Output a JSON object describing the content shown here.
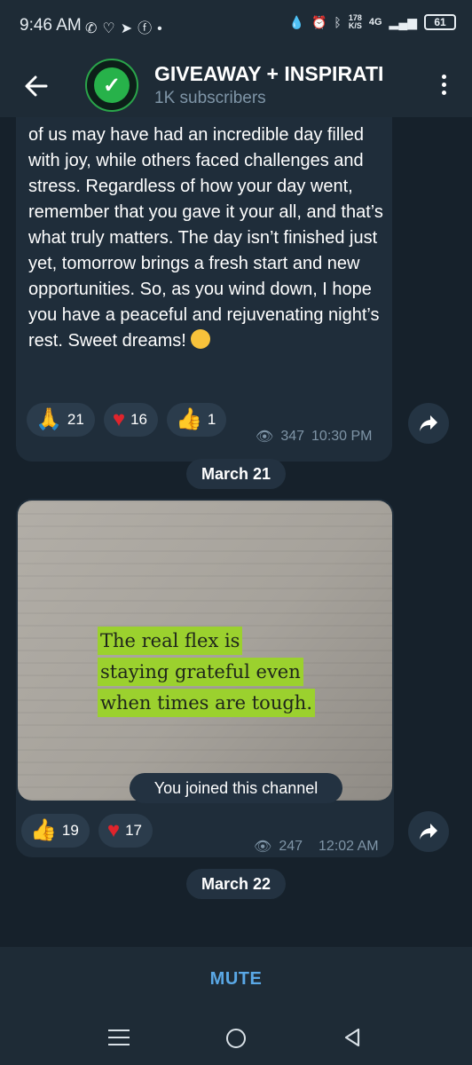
{
  "status_bar": {
    "time": "9:46 AM",
    "net_speed_value": "178",
    "net_speed_unit": "K/S",
    "network": "4G",
    "battery": "61"
  },
  "header": {
    "title": "GIVEAWAY + INSPIRATI",
    "subtitle": "1K subscribers"
  },
  "messages": [
    {
      "text": "of us may have had an incredible day filled with joy, while others faced challenges and stress. Regardless of how your day went, remember that you gave it your all, and that’s what truly matters. The day isn’t finished just yet, tomorrow brings a fresh start and new opportunities. So, as you wind down, I hope you have a peaceful and rejuvenating night’s rest. Sweet dreams!",
      "reactions": [
        {
          "icon": "folded-hands",
          "count": "21"
        },
        {
          "icon": "red-heart",
          "count": "16"
        },
        {
          "icon": "thumbs-up",
          "count": "1"
        }
      ],
      "views": "347",
      "time": "10:30 PM"
    },
    {
      "date": "March 21",
      "quote_lines": [
        "The real flex is",
        "staying grateful even",
        "when times are tough."
      ],
      "reactions": [
        {
          "icon": "thumbs-up",
          "count": "19"
        },
        {
          "icon": "red-heart",
          "count": "17"
        }
      ],
      "views": "247",
      "time": "12:02 AM"
    }
  ],
  "service": {
    "date": "March 22",
    "joined_text": "You joined this channel"
  },
  "bottom": {
    "mute_label": "MUTE"
  },
  "colors": {
    "background": "#16212b",
    "bubble": "#1f2d3a",
    "accent": "#5aa8e6",
    "highlight": "#9bd12e"
  }
}
